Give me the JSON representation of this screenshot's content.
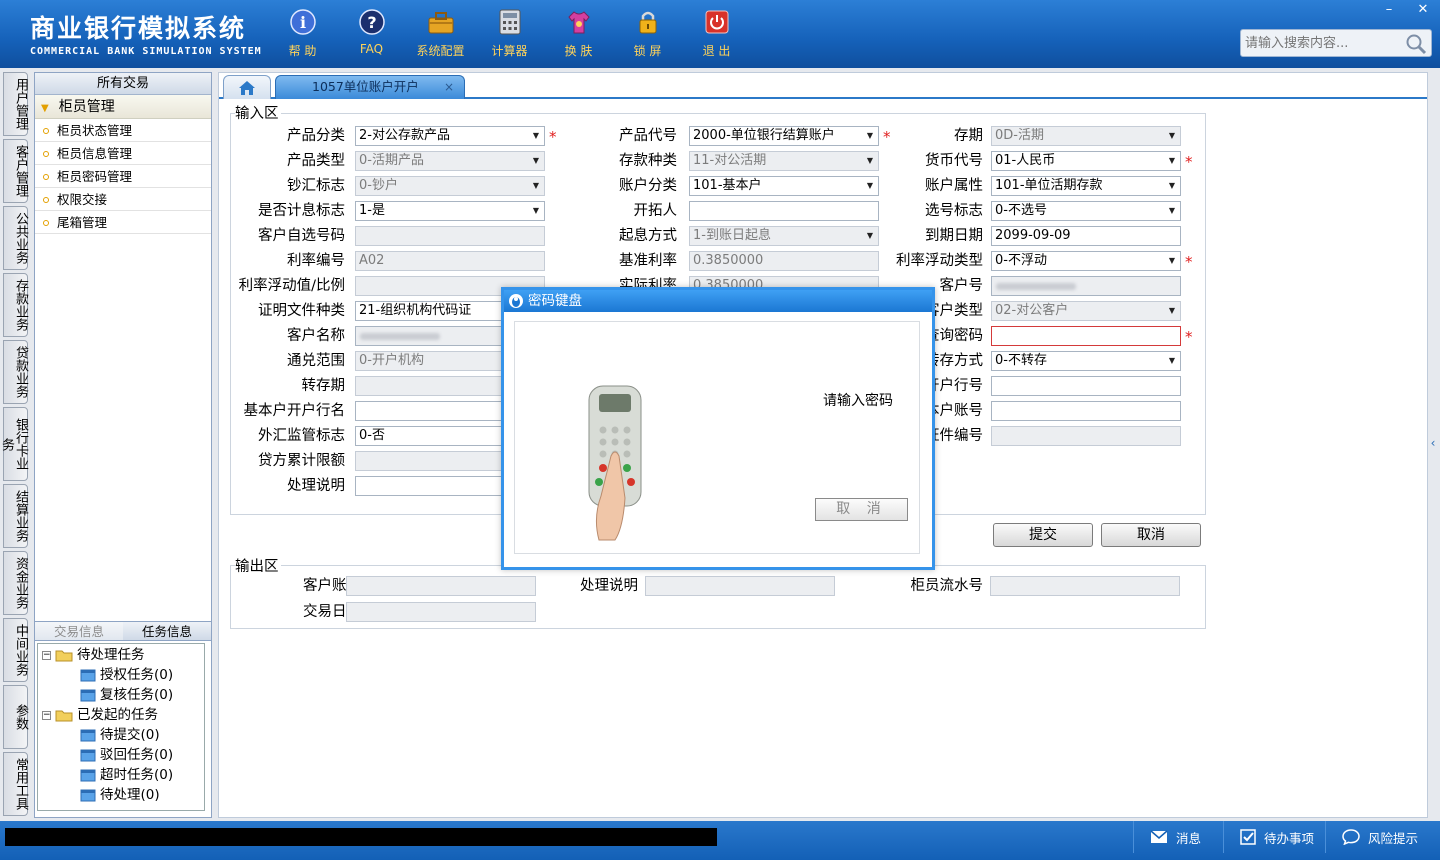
{
  "app": {
    "title_cn": "商业银行模拟系统",
    "title_en": "COMMERCIAL BANK SIMULATION SYSTEM"
  },
  "toolbar": [
    {
      "label": "帮 助",
      "icon": "info-icon"
    },
    {
      "label": "FAQ",
      "icon": "faq-icon"
    },
    {
      "label": "系统配置",
      "icon": "toolbox-icon"
    },
    {
      "label": "计算器",
      "icon": "calculator-icon"
    },
    {
      "label": "换 肤",
      "icon": "shirt-icon"
    },
    {
      "label": "锁 屏",
      "icon": "lock-icon"
    },
    {
      "label": "退 出",
      "icon": "power-icon"
    }
  ],
  "search": {
    "placeholder": "请输入搜索内容..."
  },
  "window": {
    "minimize": "–",
    "close": "✕"
  },
  "vtabs": [
    "用户管理",
    "客户管理",
    "公共业务",
    "存款业务",
    "贷款业务",
    "银行卡业务",
    "结算业务",
    "资金业务",
    "中间业务",
    "参数",
    "常用工具"
  ],
  "panel": {
    "header": "所有交易",
    "group": "柜员管理",
    "items": [
      "柜员状态管理",
      "柜员信息管理",
      "柜员密码管理",
      "权限交接",
      "尾箱管理"
    ],
    "tabs": [
      "交易信息",
      "任务信息"
    ],
    "tree": {
      "pending": "待处理任务",
      "auth": "授权任务(0)",
      "review": "复核任务(0)",
      "initiated": "已发起的任务",
      "submit": "待提交(0)",
      "rejected": "驳回任务(0)",
      "timeout": "超时任务(0)",
      "todo": "待处理(0)"
    }
  },
  "tabs": {
    "active": "1057单位账户开户",
    "close": "×"
  },
  "input": {
    "section": "输入区",
    "col1": [
      {
        "label": "产品分类",
        "value": "2-对公存款产品",
        "type": "select"
      },
      {
        "label": "产品类型",
        "value": "0-活期产品",
        "type": "select-dis"
      },
      {
        "label": "钞汇标志",
        "value": "0-钞户",
        "type": "select-dis"
      },
      {
        "label": "是否计息标志",
        "value": "1-是",
        "type": "select"
      },
      {
        "label": "客户自选号码",
        "value": "",
        "type": "dis"
      },
      {
        "label": "利率编号",
        "value": "A02",
        "type": "dis"
      },
      {
        "label": "利率浮动值/比例",
        "value": "",
        "type": "dis"
      },
      {
        "label": "证明文件种类",
        "value": "21-组织机构代码证",
        "type": "select"
      },
      {
        "label": "客户名称",
        "value": "",
        "type": "blur"
      },
      {
        "label": "通兑范围",
        "value": "0-开户机构",
        "type": "select-dis"
      },
      {
        "label": "转存期",
        "value": "",
        "type": "dis"
      },
      {
        "label": "基本户开户行名",
        "value": "",
        "type": "text"
      },
      {
        "label": "外汇监管标志",
        "value": "0-否",
        "type": "select"
      },
      {
        "label": "贷方累计限额",
        "value": "",
        "type": "dis"
      },
      {
        "label": "处理说明",
        "value": "",
        "type": "text"
      }
    ],
    "col2": [
      {
        "label": "产品代号",
        "value": "2000-单位银行结算账户",
        "type": "select"
      },
      {
        "label": "存款种类",
        "value": "11-对公活期",
        "type": "select-dis"
      },
      {
        "label": "账户分类",
        "value": "101-基本户",
        "type": "select"
      },
      {
        "label": "开拓人",
        "value": "",
        "type": "text"
      },
      {
        "label": "起息方式",
        "value": "1-到账日起息",
        "type": "select-dis"
      },
      {
        "label": "基准利率",
        "value": "0.3850000",
        "type": "dis"
      },
      {
        "label": "实际利率",
        "value": "0.3850000",
        "type": "dis"
      }
    ],
    "col3": [
      {
        "label": "存期",
        "value": "0D-活期",
        "type": "select-dis"
      },
      {
        "label": "货币代号",
        "value": "01-人民币",
        "type": "select"
      },
      {
        "label": "账户属性",
        "value": "101-单位活期存款",
        "type": "select"
      },
      {
        "label": "选号标志",
        "value": "0-不选号",
        "type": "select"
      },
      {
        "label": "到期日期",
        "value": "2099-09-09",
        "type": "text"
      },
      {
        "label": "利率浮动类型",
        "value": "0-不浮动",
        "type": "select"
      },
      {
        "label": "客户号",
        "value": "",
        "type": "blur"
      },
      {
        "label": "客户类型",
        "value": "02-对公客户",
        "type": "select-dis"
      },
      {
        "label": "查询密码",
        "value": "",
        "type": "err"
      },
      {
        "label": "转存方式",
        "value": "0-不转存",
        "type": "select"
      },
      {
        "label": "开户行号",
        "value": "",
        "type": "text"
      },
      {
        "label": "基本户账号",
        "value": "",
        "type": "text"
      },
      {
        "label": "证件编号",
        "value": "",
        "type": "dis"
      }
    ],
    "required_mark": "*",
    "submit": "提交",
    "cancel": "取消"
  },
  "output": {
    "section": "输出区",
    "fields": [
      {
        "label": "客户账号",
        "value": ""
      },
      {
        "label": "处理说明",
        "value": ""
      },
      {
        "label": "柜员流水号",
        "value": ""
      },
      {
        "label": "交易日期",
        "value": ""
      }
    ]
  },
  "dialog": {
    "title": "密码键盘",
    "message": "请输入密码",
    "cancel": "取 消"
  },
  "footer": {
    "message": "消息",
    "todo": "待办事项",
    "risk": "风险提示"
  },
  "colors": {
    "header": "#1561b9",
    "accent": "#3593ea",
    "required": "#e02020",
    "toolbar_label": "#ffd35a"
  }
}
